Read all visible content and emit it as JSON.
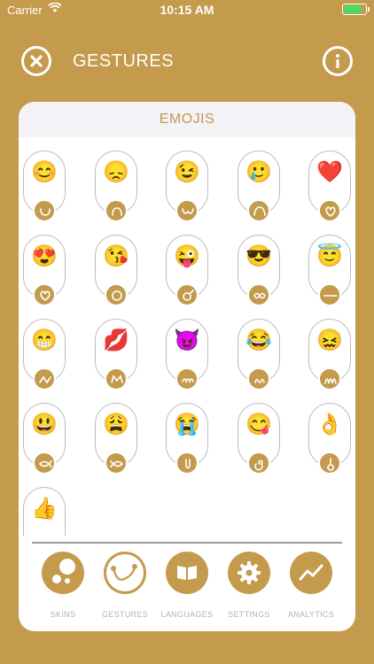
{
  "status": {
    "carrier": "Carrier",
    "time": "10:15 AM"
  },
  "header": {
    "title": "GESTURES"
  },
  "card": {
    "title": "EMOJIS"
  },
  "emojis": [
    {
      "e": "😊",
      "g": "u-loop"
    },
    {
      "e": "😞",
      "g": "n-loop"
    },
    {
      "e": "😉",
      "g": "w-loop"
    },
    {
      "e": "🥲",
      "g": "arch-loop"
    },
    {
      "e": "❤️",
      "g": "heart"
    },
    {
      "e": "😍",
      "g": "heart-loop"
    },
    {
      "e": "😘",
      "g": "circle-loop"
    },
    {
      "e": "😜",
      "g": "o-tail"
    },
    {
      "e": "😎",
      "g": "double-loop"
    },
    {
      "e": "😇",
      "g": "halo"
    },
    {
      "e": "😁",
      "g": "zigzag"
    },
    {
      "e": "💋",
      "g": "crown"
    },
    {
      "e": "😈",
      "g": "horns"
    },
    {
      "e": "😂",
      "g": "tears"
    },
    {
      "e": "😖",
      "g": "spring"
    },
    {
      "e": "😃",
      "g": "fish"
    },
    {
      "e": "😩",
      "g": "fish-reverse"
    },
    {
      "e": "😭",
      "g": "nose"
    },
    {
      "e": "😋",
      "g": "spiral"
    },
    {
      "e": "👌",
      "g": "ok"
    },
    {
      "e": "👍",
      "g": "thumb"
    }
  ],
  "nav": [
    {
      "label": "SKINS",
      "icon": "skins-icon"
    },
    {
      "label": "GESTURES",
      "icon": "gestures-icon"
    },
    {
      "label": "LANGUAGES",
      "icon": "book-icon"
    },
    {
      "label": "SETTINGS",
      "icon": "gear-icon"
    },
    {
      "label": "ANALYTICS",
      "icon": "chart-icon"
    }
  ]
}
